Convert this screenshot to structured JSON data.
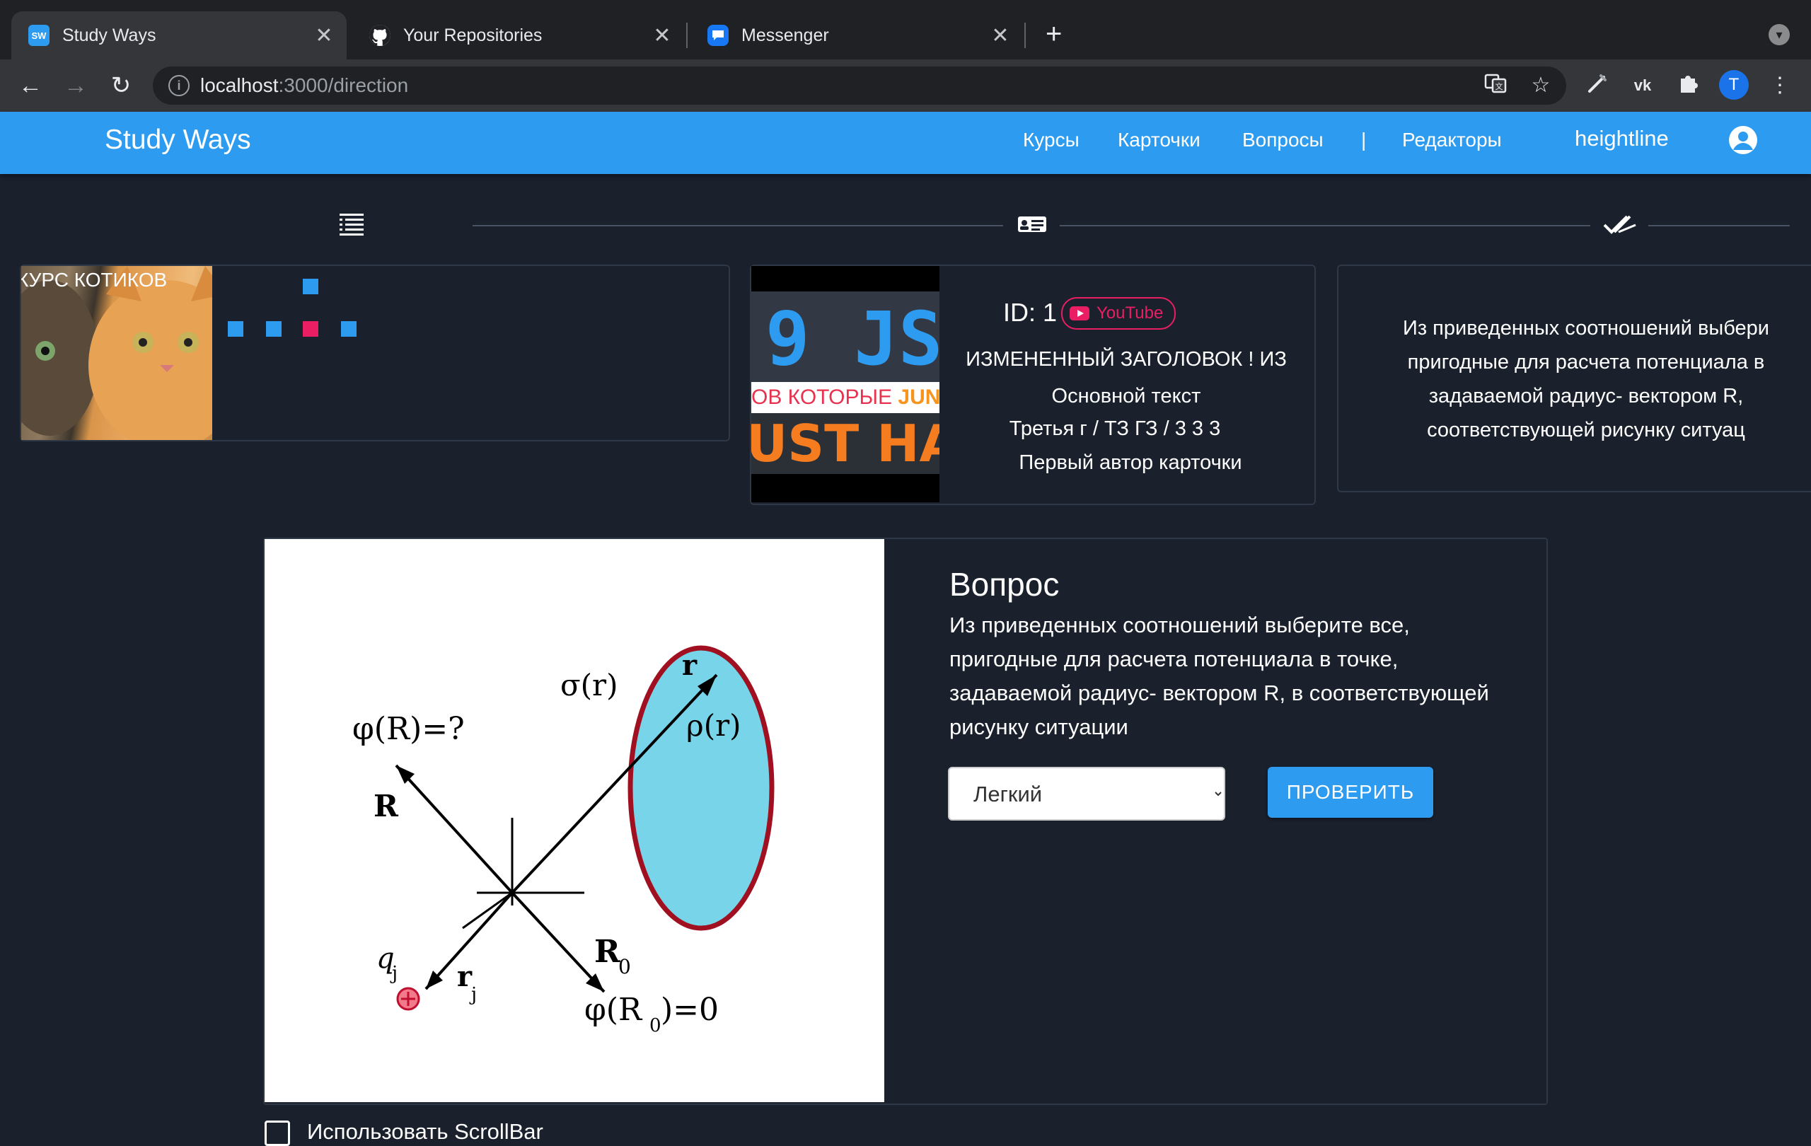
{
  "browser": {
    "tabs": [
      {
        "title": "Study Ways",
        "favicon_text": "SW"
      },
      {
        "title": "Your Repositories"
      },
      {
        "title": "Messenger"
      }
    ],
    "close_glyph": "✕",
    "new_tab_glyph": "+",
    "url_host": "localhost",
    "url_path": ":3000/direction",
    "profile_initial": "T",
    "extension_vk": "vk"
  },
  "app": {
    "brand": "Study Ways",
    "nav": [
      "Курсы",
      "Карточки",
      "Вопросы",
      "|",
      "Редакторы"
    ],
    "username": "heightline",
    "accent_color": "#2d9cf0"
  },
  "course_card": {
    "title": "КУРС КОТИКОВ"
  },
  "card": {
    "id_label": "ID: 1",
    "badge": "YouTube",
    "thumb": {
      "top": "9 JS",
      "middle_a": "ОВ КОТОРЫЕ ",
      "middle_b": "JUN",
      "bottom": "JUST HAVE"
    },
    "heading": "ИЗМЕНЕННЫЙ ЗАГОЛОВОК ! ИЗ",
    "main_text": "Основной текст",
    "meta": "Третья г  /  ТЗ ГЗ  /  3 3 3",
    "author": "Первый автор карточки"
  },
  "preview": {
    "text_lines": [
      "Из приведенных соотношений выбери",
      "пригодные для расчета потенциала в",
      "задаваемой радиус- вектором R,",
      "соответствующей рисунку ситуац"
    ]
  },
  "question": {
    "title": "Вопрос",
    "text": "Из приведенных соотношений выберите все, пригодные для расчета потенциала в точке, задаваемой радиус- вектором R, в соответствующей рисунку ситуации",
    "difficulty_selected": "Легкий",
    "check_button": "ПРОВЕРИТЬ",
    "figure_labels": {
      "phi_R": "φ(R)=?",
      "sigma": "σ(r)",
      "r": "r",
      "rho": "ρ(r)",
      "R": "R",
      "R0": "R",
      "R0_sub": "0",
      "qj": "q",
      "qj_sub": "j",
      "rj": "r",
      "rj_sub": "j",
      "phi_R0": "φ(R",
      "phi_R0_sub": "0",
      "phi_R0_tail": ")=0"
    }
  },
  "footer": {
    "scrollbar_label": "Использовать ScrollBar"
  }
}
